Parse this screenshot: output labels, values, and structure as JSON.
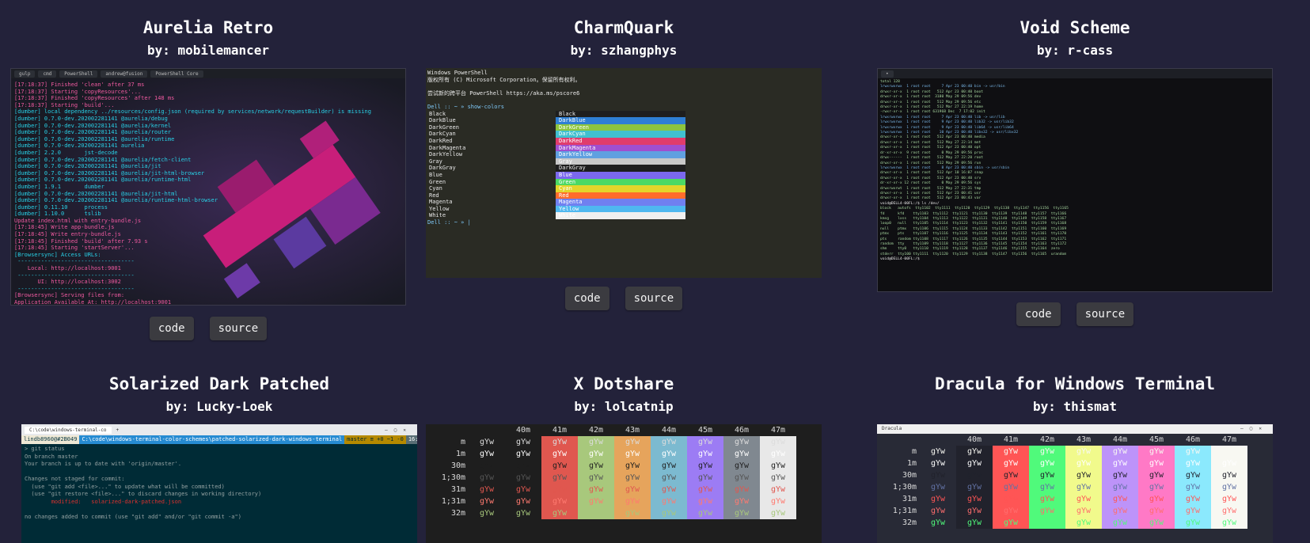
{
  "cards": [
    {
      "title": "Aurelia Retro",
      "author": "by: mobilemancer",
      "code_label": "code",
      "source_label": "source",
      "terminal": {
        "tabs": [
          "gulp",
          "cmd",
          "PowerShell",
          "andrew@fusion",
          "PowerShell Core"
        ],
        "lines": [
          "[17:18:37] Finished 'clean' after 37 ms",
          "[17:18:37] Starting 'copyResources'...",
          "[17:18:37] Finished 'copyResources' after 148 ms",
          "[17:18:37] Starting 'build'...",
          "[dumber] local dependency ../resources/config.json (required by services/network/requestBuilder) is missing",
          "[dumber] 0.7.0-dev.202002281141 @aurelia/debug",
          "[dumber] 0.7.0-dev.202002281141 @aurelia/kernel",
          "[dumber] 0.7.0-dev.202002281141 @aurelia/router",
          "[dumber] 0.7.0-dev.202002281141 @aurelia/runtime",
          "[dumber] 0.7.0-dev.202002281141 aurelia",
          "[dumber] 2.2.0       jst-decode",
          "[dumber] 0.7.0-dev.202002281141 @aurelia/fetch-client",
          "[dumber] 0.7.0-dev.202002281141 @aurelia/jit",
          "[dumber] 0.7.0-dev.202002281141 @aurelia/jit-html-browser",
          "[dumber] 0.7.0-dev.202002281141 @aurelia/runtime-html",
          "[dumber] 1.9.1       dumber",
          "[dumber] 0.7.0-dev.202002281141 @aurelia/jit-html",
          "[dumber] 0.7.0-dev.202002281141 @aurelia/runtime-html-browser",
          "[dumber] 0.11.10     process",
          "[dumber] 1.10.0      tslib",
          "Update index.html with entry-bundle.js",
          "[17:18:45] Write app-bundle.js",
          "[17:18:45] Write entry-bundle.js",
          "[17:18:45] Finished 'build' after 7.93 s",
          "[17:18:45] Starting 'startServer'...",
          "[Browsersync] Access URLs:",
          " -----------------------------------",
          "    Local: http://localhost:9001",
          " -----------------------------------",
          "       UI: http://localhost:3002",
          " -----------------------------------",
          "[Browsersync] Serving files from:",
          "Application Available At: http://localhost:9001",
          "BrowserSync Available At: http://localhost:3002",
          "[17:18:46] Finished 'startServer' after 937 ms",
          "[17:18:46] Starting 'watch'..."
        ]
      }
    },
    {
      "title": "CharmQuark",
      "author": "by: szhangphys",
      "code_label": "code",
      "source_label": "source",
      "terminal": {
        "header": [
          "Windows PowerShell",
          "版权所有 (C) Microsoft Corporation。保留所有权利。",
          "",
          "尝试新的跨平台 PowerShell https://aka.ms/pscore6",
          ""
        ],
        "prompt": "Dell :: ~ » show-colors",
        "end_prompt": "Dell :: ~ » |",
        "colors": [
          "Black",
          "DarkBlue",
          "DarkGreen",
          "DarkCyan",
          "DarkRed",
          "DarkMagenta",
          "DarkYellow",
          "Gray",
          "DarkGray",
          "Blue",
          "Green",
          "Cyan",
          "Red",
          "Magenta",
          "Yellow",
          "White"
        ],
        "swatches": [
          "#1e1e1e",
          "#2f7fd4",
          "#8dc53e",
          "#40c0d0",
          "#e03c6c",
          "#a04fd0",
          "#60a0e0",
          "#c8c8c8",
          "#1e1e1e",
          "#7b68ee",
          "#4cd964",
          "#e4d52a",
          "#ff6c2c",
          "#7080f0",
          "#4fb8f0",
          "#f0f0f0"
        ],
        "accent": "#7fc8f8"
      }
    },
    {
      "title": "Void Scheme",
      "author": "by: r-cass",
      "code_label": "code",
      "source_label": "source",
      "terminal": {
        "lines": [
          "total 128",
          "lrwxrwxrwx  1 root root     7 Apr 23 00:40 bin -> usr/bin",
          "drwxr-xr-x  1 root root   512 Apr 23 00:40 boot",
          "drwxr-xr-x  1 root root  3180 May 29 09:56 dev",
          "drwxr-xr-x  1 root root   512 May 29 09:56 etc",
          "drwxr-xr-x  1 root root   512 Mar 27 22:19 home",
          "-rwxr-xr-x  1 root root 631968 Dec  7 17:02 init",
          "lrwxrwxrwx  1 root root     7 Apr 23 00:40 lib -> usr/lib",
          "lrwxrwxrwx  1 root root     9 Apr 23 00:40 lib32 -> usr/lib32",
          "lrwxrwxrwx  1 root root     9 Apr 23 00:40 lib64 -> usr/lib64",
          "lrwxrwxrwx  1 root root    10 Apr 23 00:40 libx32 -> usr/libx32",
          "drwxr-xr-x  1 root root   512 Apr 23 00:40 media",
          "drwxr-xr-x  1 root root   512 May 27 22:14 mnt",
          "drwxr-xr-x  1 root root   512 Apr 23 00:40 opt",
          "dr-xr-xr-x  9 root root     0 May 29 09:56 proc",
          "drwx------  1 root root   512 May 27 22:20 root",
          "drwxr-xr-x  1 root root   512 May 29 09:56 run",
          "lrwxrwxrwx  1 root root     8 Apr 23 00:40 sbin -> usr/sbin",
          "drwxr-xr-x  1 root root   512 Apr 10 16:07 snap",
          "drwxr-xr-x  1 root root   512 Apr 23 00:40 srv",
          "dr-xr-xr-x 12 root root     0 May 29 09:56 sys",
          "drwxrwxrwt  1 root root   512 May 27 22:31 tmp",
          "drwxr-xr-x  1 root root   512 Apr 23 00:41 usr",
          "drwxr-xr-x  1 root root   512 Apr 23 00:43 var",
          "void@DELL4-00FL:/$ ls /dev/",
          "block   autofs  tty1102  tty1111  tty1120  tty1129  tty1138  tty1147  tty1156  tty1165",
          "fd      kfd    tty1103  tty1112  tty1121  tty1130  tty1139  tty1148  tty1157  tty1166",
          "kmsg    lxss   tty1104  tty1113  tty1122  tty1131  tty1140  tty1149  tty1158  tty1167",
          "loop0   null   tty1105  tty1114  tty1123  tty1132  tty1141  tty1150  tty1159  tty1168",
          "null    ptmx   tty1106  tty1115  tty1124  tty1133  tty1142  tty1151  tty1160  tty1169",
          "ptmx    pts    tty1107  tty1116  tty1125  tty1134  tty1143  tty1152  tty1161  tty1170",
          "pts     random tty1108  tty1117  tty1126  tty1135  tty1144  tty1153  tty1162  tty1171",
          "random  tty    tty1109  tty1118  tty1127  tty1136  tty1145  tty1154  tty1163  tty1172",
          "shm     tty0   tty1110  tty1119  tty1128  tty1137  tty1146  tty1155  tty1164  zero",
          "stderr  tty100 tty1111  tty1120  tty1129  tty1138  tty1147  tty1156  tty1165  urandom",
          "void@DELL4-00FL:/$"
        ]
      }
    },
    {
      "title": "Solarized Dark Patched",
      "author": "by: Lucky-Loek",
      "code_label": "code",
      "source_label": "source",
      "terminal": {
        "tab": "C:\\code\\windows-terminal-co",
        "prompt_user": "lindb8960@#2B049",
        "prompt_path": "C:\\code\\windows-terminal-color-schemes\\patched-solarized-dark-windows-terminal",
        "prompt_branch": "master ≡ +0 ~1 -0",
        "prompt_time": "16:35",
        "lines": [
          "> git status",
          "On branch master",
          "Your branch is up to date with 'origin/master'.",
          "",
          "Changes not staged for commit:",
          "  (use \"git add <file>...\" to update what will be committed)",
          "  (use \"git restore <file>...\" to discard changes in working directory)",
          "        modified:   solarized-dark-patched.json",
          "",
          "no changes added to commit (use \"git add\" and/or \"git commit -a\")"
        ]
      }
    },
    {
      "title": "X Dotshare",
      "author": "by: lolcatnip",
      "code_label": "code",
      "source_label": "source",
      "terminal": {
        "headers": [
          "",
          "",
          "40m",
          "41m",
          "42m",
          "43m",
          "44m",
          "45m",
          "46m",
          "47m"
        ],
        "rows": [
          "m",
          "1m",
          "30m",
          "1;30m",
          "31m",
          "1;31m",
          "32m"
        ],
        "cell": "gYw",
        "bg_colors": [
          "#1e1e1e",
          "#1e1e1e",
          "#1e1e1e",
          "#e0574f",
          "#a8c87c",
          "#e6a45c",
          "#7cbad0",
          "#9c7cf4",
          "#808890",
          "#e8e8e8"
        ],
        "fg_colors": [
          "#dcdcdc",
          "#ffffff",
          "#1e1e1e",
          "#555555",
          "#e0574f",
          "#ff7a70",
          "#a8c87c"
        ]
      }
    },
    {
      "title": "Dracula for Windows Terminal",
      "author": "by: thismat",
      "code_label": "code",
      "source_label": "source",
      "terminal": {
        "window_title": "Dracula",
        "headers": [
          "",
          "",
          "40m",
          "41m",
          "42m",
          "43m",
          "44m",
          "45m",
          "46m",
          "47m"
        ],
        "rows": [
          "m",
          "1m",
          "30m",
          "1;30m",
          "31m",
          "1;31m",
          "32m"
        ],
        "cell": "gYw",
        "bg_colors": [
          "#282a36",
          "#282a36",
          "#21222c",
          "#ff5555",
          "#50fa7b",
          "#f1fa8c",
          "#bd93f9",
          "#ff79c6",
          "#8be9fd",
          "#f8f8f2"
        ],
        "fg_colors": [
          "#f8f8f2",
          "#ffffff",
          "#21222c",
          "#6272a4",
          "#ff5555",
          "#ff6e6e",
          "#50fa7b"
        ]
      }
    }
  ]
}
